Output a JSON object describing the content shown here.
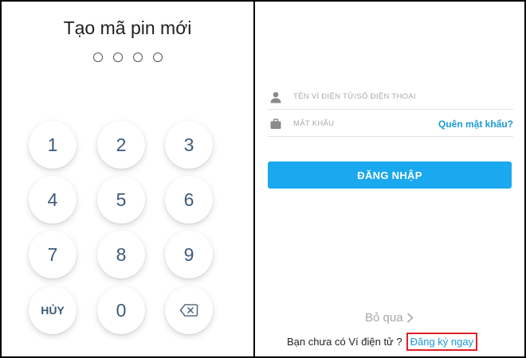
{
  "pin_screen": {
    "title": "Tạo mã pin mới",
    "dot_count": 4,
    "keys": [
      "1",
      "2",
      "3",
      "4",
      "5",
      "6",
      "7",
      "8",
      "9",
      "HỦY",
      "0",
      "backspace"
    ],
    "cancel_label": "HỦY",
    "backspace_icon": "backspace-icon",
    "key_text_color": "#3d5a7a"
  },
  "login_screen": {
    "username_placeholder": "TÊN VÍ ĐIỆN TỬ/SỐ ĐIỆN THOẠI",
    "password_placeholder": "MẬT KHẨU",
    "forgot_password": "Quên mật khẩu?",
    "login_button": "ĐĂNG NHẬP",
    "skip": "Bỏ qua",
    "signup_prompt": "Bạn chưa có Ví điện tử ?",
    "signup_link": "Đăng ký ngay",
    "accent_color": "#1aa8ee",
    "highlight_color": "#e0202a"
  }
}
